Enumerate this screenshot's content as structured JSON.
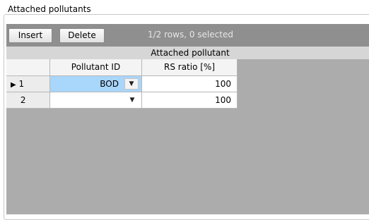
{
  "group": {
    "title": "Attached pollutants"
  },
  "toolbar": {
    "insert_label": "Insert",
    "delete_label": "Delete",
    "status_text": "1/2 rows, 0 selected"
  },
  "band": {
    "label": "Attached pollutant"
  },
  "table": {
    "columns": [
      "Pollutant ID",
      "RS ratio [%]"
    ],
    "rows": [
      {
        "row_label": "1",
        "current_marker": "▶",
        "pollutant_id": "BOD",
        "rs_ratio": "100"
      },
      {
        "row_label": "2",
        "current_marker": "",
        "pollutant_id": "",
        "rs_ratio": "100"
      }
    ]
  },
  "icons": {
    "dropdown": "dropdown-arrow-icon"
  },
  "colors": {
    "selected_cell": "#a9d6fb",
    "toolbar": "#8f8f8f",
    "panel": "#acacac"
  }
}
